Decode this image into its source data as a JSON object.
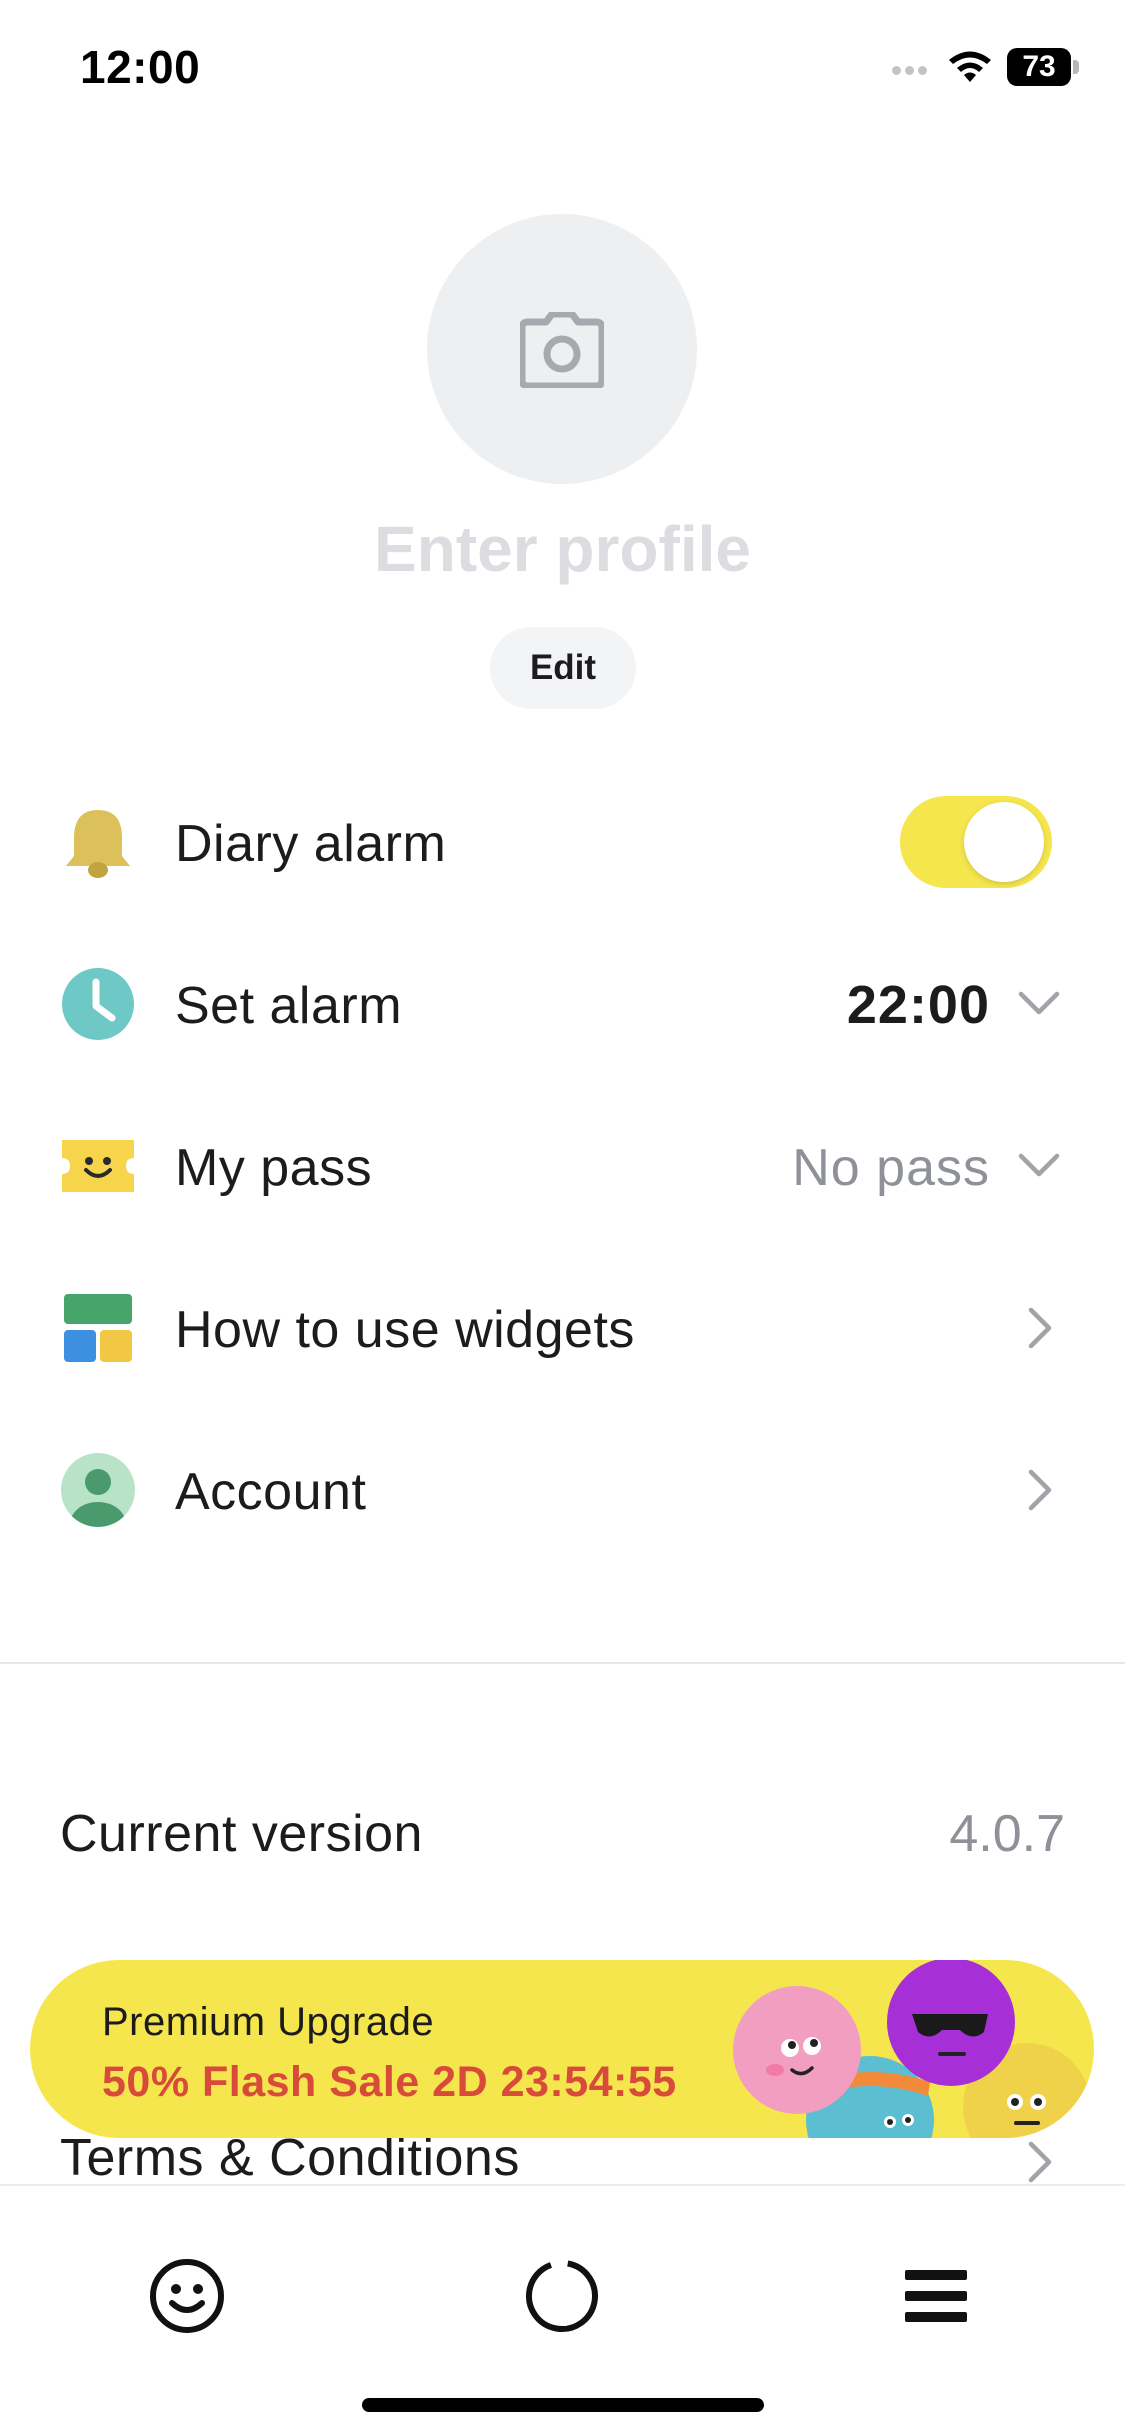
{
  "status_bar": {
    "time": "12:00",
    "battery_level": "73",
    "icons": [
      "signal-dots-icon",
      "wifi-icon",
      "battery-icon"
    ]
  },
  "profile": {
    "avatar_icon": "camera-icon",
    "name_placeholder": "Enter profile",
    "edit_label": "Edit"
  },
  "settings": {
    "diary_alarm": {
      "icon": "bell-icon",
      "label": "Diary alarm",
      "enabled": true
    },
    "set_alarm": {
      "icon": "clock-icon",
      "label": "Set alarm",
      "value": "22:00"
    },
    "my_pass": {
      "icon": "ticket-icon",
      "label": "My pass",
      "value": "No pass"
    },
    "widgets": {
      "icon": "widgets-icon",
      "label": "How to use widgets"
    },
    "account": {
      "icon": "person-icon",
      "label": "Account"
    }
  },
  "about": {
    "version_label": "Current version",
    "version_value": "4.0.7",
    "terms_label": "Terms & Conditions"
  },
  "promo": {
    "title": "Premium Upgrade",
    "sale_text": "50% Flash Sale 2D 23:54:55"
  },
  "tab_bar": {
    "tabs": [
      "smiley-icon",
      "progress-ring-icon",
      "menu-icon"
    ]
  },
  "colors": {
    "accent_yellow": "#f5e64e",
    "sale_red": "#d84a3a",
    "muted_gray": "#8e9198",
    "bell": "#dcc05a",
    "clock": "#6ec8c6",
    "ticket": "#f6d54c",
    "widget_green": "#45a56a",
    "widget_blue": "#3d8fe0",
    "widget_yellow": "#f2c744",
    "account_green": "#4a9a6e"
  }
}
